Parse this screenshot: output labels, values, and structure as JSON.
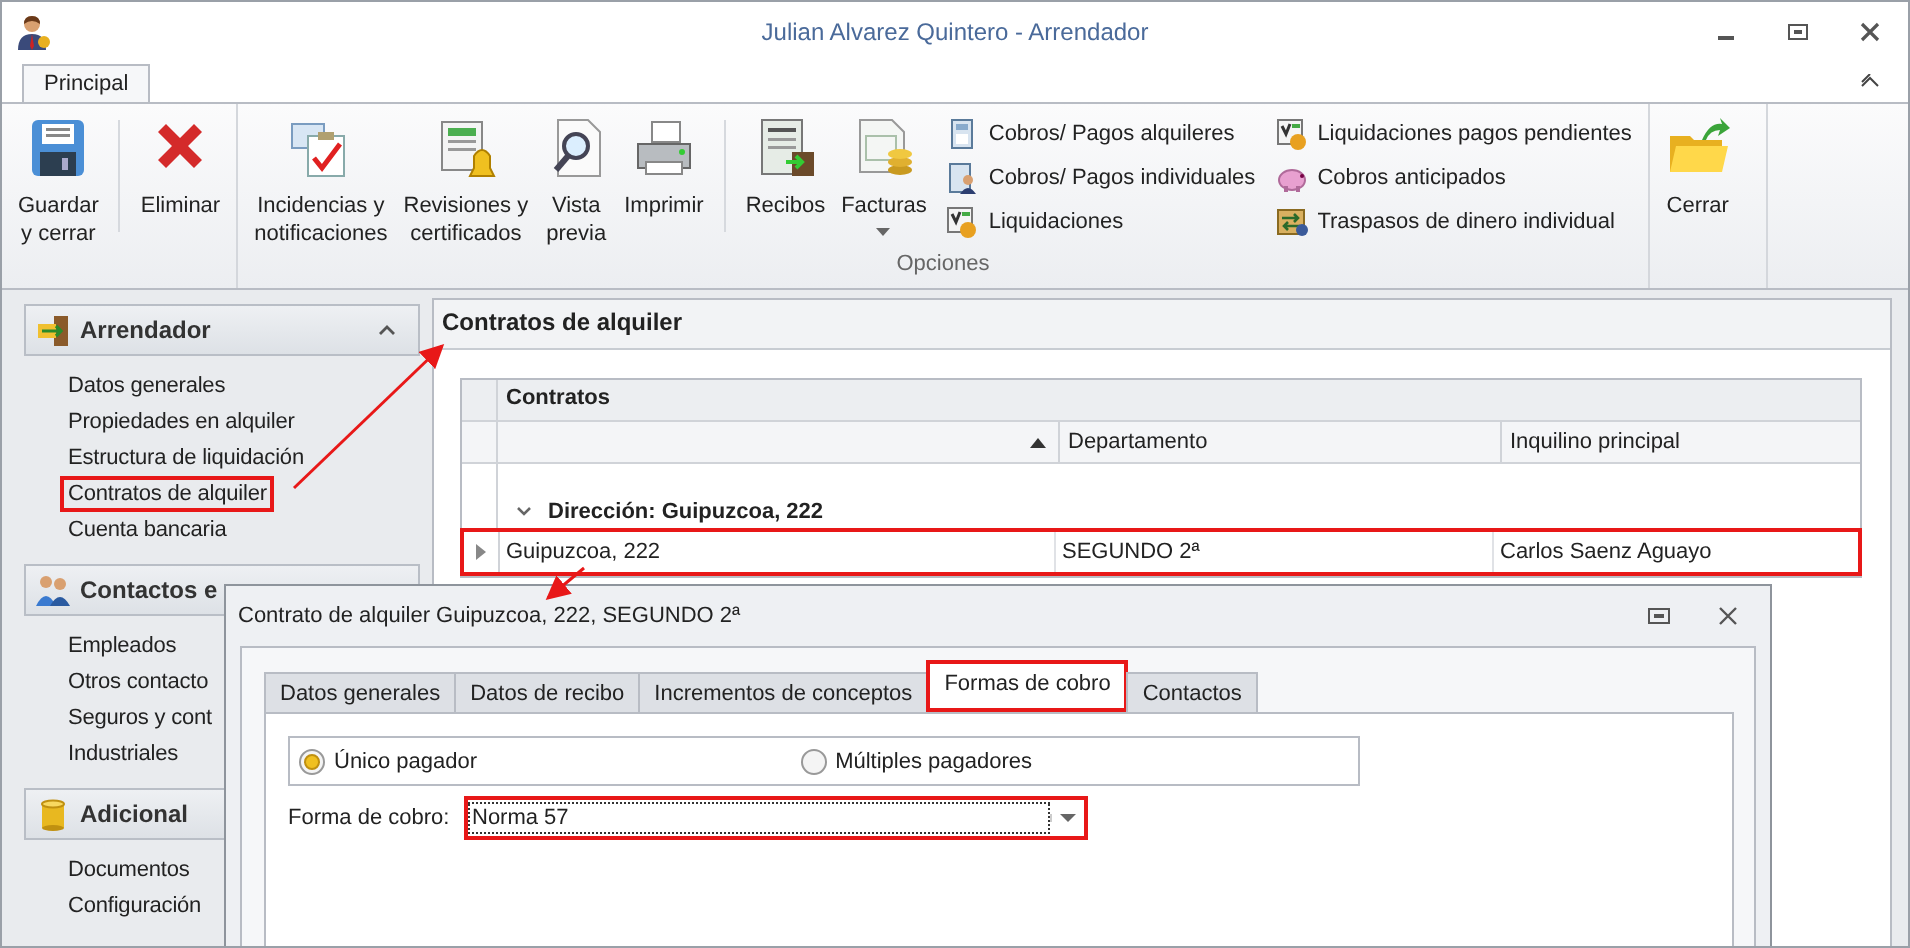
{
  "window": {
    "title": "Julian Alvarez Quintero - Arrendador"
  },
  "ribbon": {
    "tabs": [
      {
        "label": "Principal",
        "selected": true
      }
    ],
    "groups": [
      {
        "items": [
          {
            "kind": "large",
            "lines": [
              "Guardar",
              "y cerrar"
            ],
            "dropdown": false
          },
          {
            "kind": "separator"
          },
          {
            "kind": "large",
            "lines": [
              "Eliminar"
            ],
            "dropdown": false
          }
        ]
      },
      {
        "label": "Opciones",
        "items": [
          {
            "kind": "large",
            "lines": [
              "Incidencias y",
              "notificaciones"
            ],
            "dropdown": false
          },
          {
            "kind": "large",
            "lines": [
              "Revisiones y",
              "certificados"
            ],
            "dropdown": false
          },
          {
            "kind": "large",
            "lines": [
              "Vista",
              "previa"
            ],
            "dropdown": false
          },
          {
            "kind": "large",
            "lines": [
              "Imprimir"
            ],
            "dropdown": false
          },
          {
            "kind": "separator"
          },
          {
            "kind": "large",
            "lines": [
              "Recibos"
            ],
            "dropdown": false
          },
          {
            "kind": "large",
            "lines": [
              "Facturas"
            ],
            "dropdown": true
          },
          {
            "kind": "column",
            "entries": [
              "Cobros/ Pagos alquileres",
              "Cobros/ Pagos individuales",
              "Liquidaciones"
            ]
          },
          {
            "kind": "column",
            "entries": [
              "Liquidaciones pagos pendientes",
              "Cobros anticipados",
              "Traspasos de dinero individual"
            ]
          }
        ]
      },
      {
        "items": [
          {
            "kind": "large",
            "lines": [
              "Cerrar"
            ],
            "dropdown": false
          }
        ]
      }
    ]
  },
  "nav": {
    "groups": [
      {
        "title": "Arrendador",
        "expanded": true,
        "items": [
          {
            "label": "Datos generales",
            "highlighted": false
          },
          {
            "label": "Propiedades en alquiler",
            "highlighted": false
          },
          {
            "label": "Estructura de liquidación",
            "highlighted": false
          },
          {
            "label": "Contratos de alquiler",
            "highlighted": true
          },
          {
            "label": "Cuenta bancaria",
            "highlighted": false
          }
        ]
      },
      {
        "title": "Contactos e",
        "items": [
          {
            "label": "Empleados",
            "highlighted": false
          },
          {
            "label": "Otros contacto",
            "highlighted": false
          },
          {
            "label": "Seguros y cont",
            "highlighted": false
          },
          {
            "label": "Industriales",
            "highlighted": false
          }
        ]
      },
      {
        "title": "Adicional",
        "items": [
          {
            "label": "Documentos",
            "highlighted": false
          },
          {
            "label": "Configuración",
            "highlighted": false
          }
        ]
      }
    ]
  },
  "content": {
    "title": "Contratos de alquiler",
    "grid": {
      "caption": "Contratos",
      "columns": [
        {
          "sort_ascending": true
        },
        {
          "label": "Departamento",
          "sort_ascending": false
        },
        {
          "label": "Inquilino principal",
          "sort_ascending": false
        }
      ],
      "groups": [
        {
          "label": "Dirección: Guipuzcoa, 222",
          "expanded": true,
          "rows": [
            {
              "current": true,
              "highlighted": true,
              "cells": [
                "Guipuzcoa, 222",
                "SEGUNDO 2ª",
                "Carlos Saenz Aguayo"
              ]
            }
          ]
        }
      ]
    }
  },
  "dialog": {
    "title": "Contrato de alquiler Guipuzcoa, 222, SEGUNDO 2ª",
    "tabs": [
      {
        "label": "Datos generales",
        "selected": false,
        "highlighted": false
      },
      {
        "label": "Datos de recibo",
        "selected": false,
        "highlighted": false
      },
      {
        "label": "Incrementos de conceptos",
        "selected": false,
        "highlighted": false
      },
      {
        "label": "Formas de cobro",
        "selected": true,
        "highlighted": true
      },
      {
        "label": "Contactos",
        "selected": false,
        "highlighted": false
      }
    ],
    "payer_options": [
      {
        "label": "Único pagador",
        "selected": true
      },
      {
        "label": "Múltiples pagadores",
        "selected": false
      }
    ],
    "payment_method": {
      "label": "Forma de cobro:",
      "value": "Norma 57",
      "highlighted": true
    }
  }
}
